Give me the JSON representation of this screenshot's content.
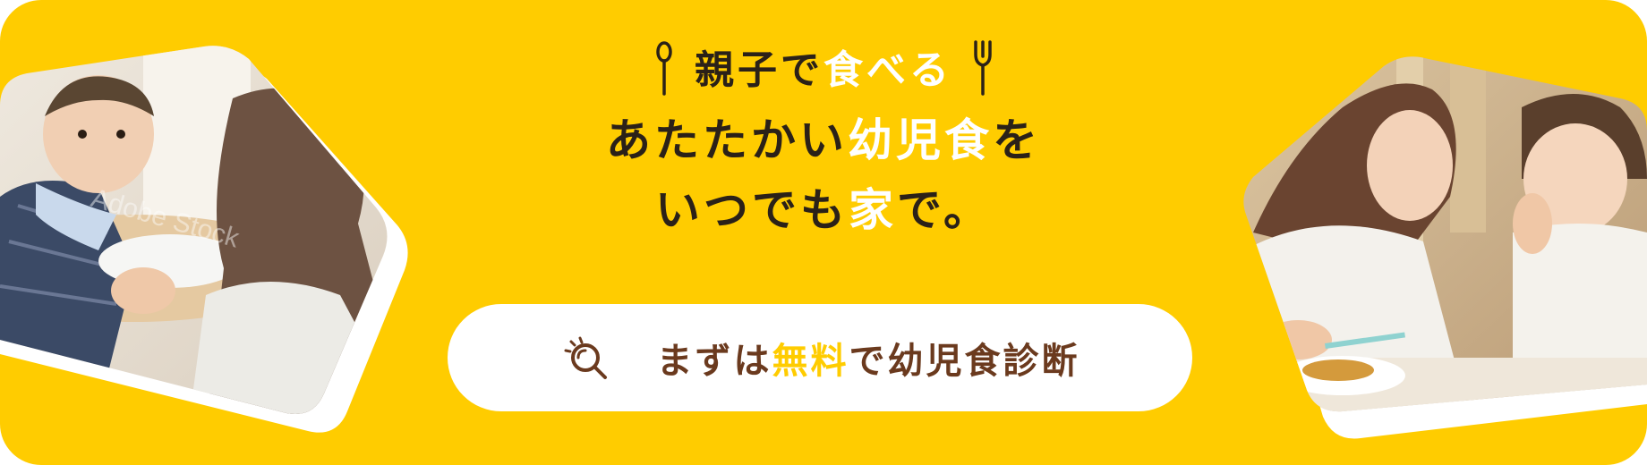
{
  "colors": {
    "background": "#FFCC00",
    "text_dark": "#2b2118",
    "accent_white": "#ffffff",
    "cta_text": "#6b3a1e",
    "cta_accent": "#FFCC00"
  },
  "headline": {
    "line1_pre": "親子で",
    "line1_accent": "食べる",
    "line2_pre": "あたたかい",
    "line2_accent": "幼児食",
    "line2_post": "を",
    "line3_pre": "いつでも",
    "line3_accent": "家",
    "line3_post": "で。"
  },
  "cta": {
    "label_pre": "まずは",
    "label_accent": "無料",
    "label_post": "で幼児食診断",
    "icon": "search-icon"
  },
  "photos": {
    "left": {
      "watermark": "Adobe Stock",
      "subject": "baby-being-fed-photo"
    },
    "right": {
      "subject": "mother-and-child-eating-photo"
    }
  }
}
